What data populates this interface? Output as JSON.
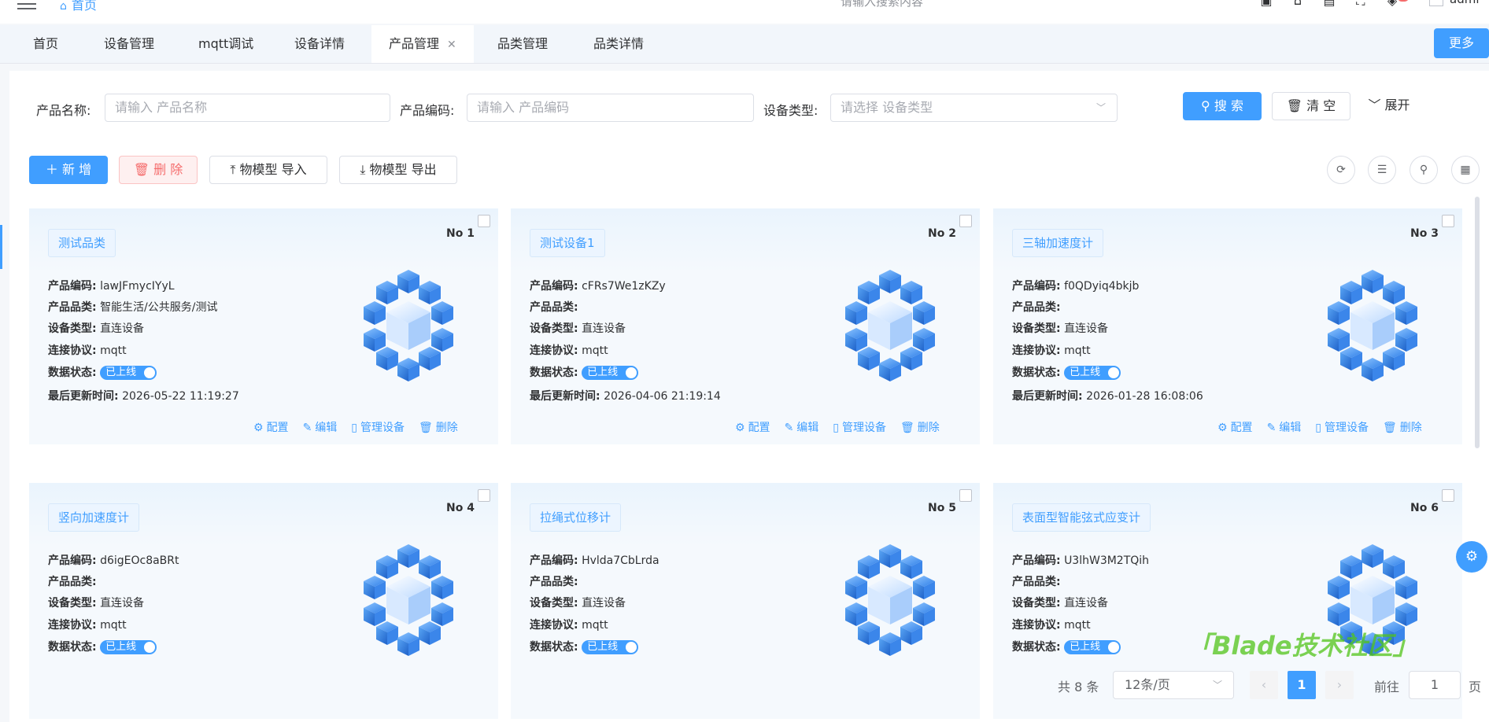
{
  "header": {
    "home_label": "首页",
    "search_placeholder": "请输入搜索内容",
    "user_name": "admi",
    "icons": [
      "lock-icon",
      "shirt-icon",
      "translate-icon",
      "fullscreen-icon",
      "bell-icon"
    ]
  },
  "tabs": [
    {
      "label": "首页"
    },
    {
      "label": "设备管理"
    },
    {
      "label": "mqtt调试"
    },
    {
      "label": "设备详情"
    },
    {
      "label": "产品管理",
      "active": true
    },
    {
      "label": "品类管理"
    },
    {
      "label": "品类详情"
    }
  ],
  "more_label": "更多",
  "filters": {
    "name_label": "产品名称:",
    "name_placeholder": "请输入 产品名称",
    "code_label": "产品编码:",
    "code_placeholder": "请输入 产品编码",
    "type_label": "设备类型:",
    "type_placeholder": "请选择 设备类型",
    "search_btn": "搜 索",
    "clear_btn": "清 空",
    "expand_btn": "展开"
  },
  "toolbar": {
    "add_btn": "新 增",
    "delete_btn": "删 除",
    "import_btn": "物模型 导入",
    "export_btn": "物模型 导出"
  },
  "field_labels": {
    "code": "产品编码:",
    "category": "产品品类:",
    "device_type": "设备类型:",
    "protocol": "连接协议:",
    "status": "数据状态:",
    "updated": "最后更新时间:"
  },
  "card_actions": {
    "config": "配置",
    "edit": "编辑",
    "manage": "管理设备",
    "delete": "删除"
  },
  "products": [
    {
      "no": "No 1",
      "name": "测试品类",
      "code": "lawJFmycIYyL",
      "category": "智能生活/公共服务/测试",
      "device_type": "直连设备",
      "protocol": "mqtt",
      "status": "已上线",
      "updated": "2026-05-22 11:19:27"
    },
    {
      "no": "No 2",
      "name": "测试设备1",
      "code": "cFRs7We1zKZy",
      "category": "",
      "device_type": "直连设备",
      "protocol": "mqtt",
      "status": "已上线",
      "updated": "2026-04-06 21:19:14"
    },
    {
      "no": "No 3",
      "name": "三轴加速度计",
      "code": "f0QDyiq4bkjb",
      "category": "",
      "device_type": "直连设备",
      "protocol": "mqtt",
      "status": "已上线",
      "updated": "2026-01-28 16:08:06"
    },
    {
      "no": "No 4",
      "name": "竖向加速度计",
      "code": "d6igEOc8aBRt",
      "category": "",
      "device_type": "直连设备",
      "protocol": "mqtt",
      "status": "已上线",
      "updated": ""
    },
    {
      "no": "No 5",
      "name": "拉绳式位移计",
      "code": "Hvlda7CbLrda",
      "category": "",
      "device_type": "直连设备",
      "protocol": "mqtt",
      "status": "已上线",
      "updated": ""
    },
    {
      "no": "No 6",
      "name": "表面型智能弦式应变计",
      "code": "U3lhW3M2TQih",
      "category": "",
      "device_type": "直连设备",
      "protocol": "mqtt",
      "status": "已上线",
      "updated": ""
    }
  ],
  "pagination": {
    "total": "共 8 条",
    "page_size": "12条/页",
    "current": "1",
    "goto_label": "前往",
    "goto_value": "1",
    "page_suffix": "页"
  },
  "watermark": "「Blade技术社区」",
  "colors": {
    "primary": "#409eff",
    "danger": "#f56c6c"
  }
}
